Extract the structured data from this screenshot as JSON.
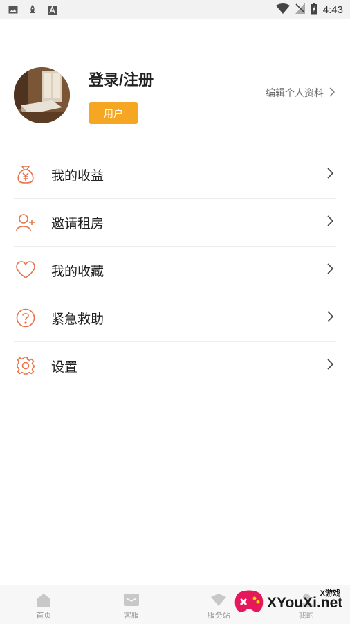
{
  "status_bar": {
    "time": "4:43",
    "left_icons": [
      "image-icon",
      "rocket-icon",
      "text-icon"
    ],
    "right_icons": [
      "wifi-icon",
      "no-signal-icon",
      "battery-icon"
    ]
  },
  "profile": {
    "username": "登录/注册",
    "role_badge": "用户",
    "edit_profile": "编辑个人资料",
    "accent": "#f5a623"
  },
  "menu": {
    "items": [
      {
        "label": "我的收益",
        "icon": "money-bag-icon"
      },
      {
        "label": "邀请租房",
        "icon": "add-user-icon"
      },
      {
        "label": "我的收藏",
        "icon": "heart-icon"
      },
      {
        "label": "紧急救助",
        "icon": "help-circle-icon"
      },
      {
        "label": "设置",
        "icon": "gear-icon"
      }
    ],
    "icon_color": "#e8734a"
  },
  "tabbar": {
    "tabs": [
      {
        "label": "首页",
        "icon": "home-icon"
      },
      {
        "label": "客服",
        "icon": "inbox-icon"
      },
      {
        "label": "服务站",
        "icon": "service-icon"
      },
      {
        "label": "我的",
        "icon": "user-icon"
      }
    ]
  },
  "watermark": {
    "brand": "XYouXi.net",
    "top_text": "X游戏"
  }
}
